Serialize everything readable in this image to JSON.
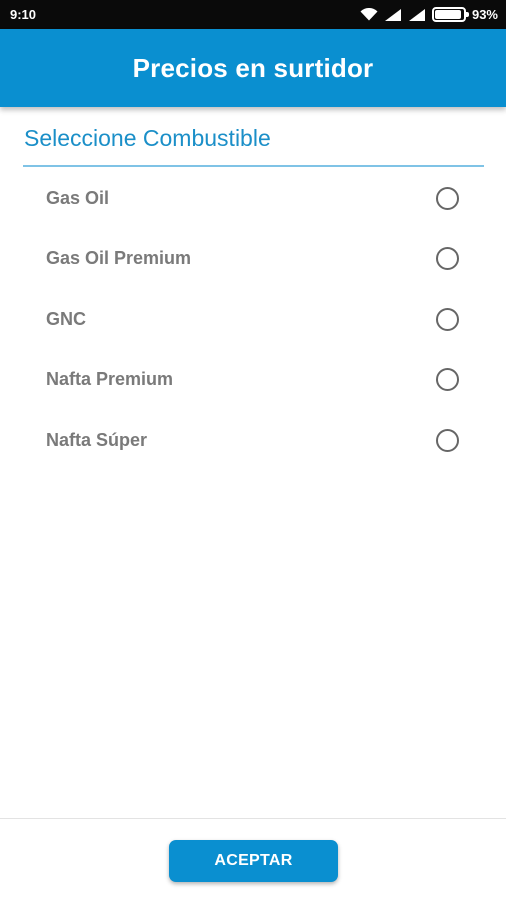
{
  "status_bar": {
    "time": "9:10",
    "battery_percent": "93%",
    "battery_level": 0.93,
    "icons": [
      "wifi-icon",
      "signal-icon",
      "signal-icon",
      "battery-icon"
    ]
  },
  "app_bar": {
    "title": "Precios en surtidor"
  },
  "fuel_section": {
    "title": "Seleccione Combustible",
    "options": [
      {
        "label": "Gas Oil",
        "selected": false
      },
      {
        "label": "Gas Oil Premium",
        "selected": false
      },
      {
        "label": "GNC",
        "selected": false
      },
      {
        "label": "Nafta Premium",
        "selected": false
      },
      {
        "label": "Nafta Súper",
        "selected": false
      }
    ]
  },
  "footer": {
    "accept_label": "ACEPTAR"
  },
  "colors": {
    "primary": "#0a8fd0",
    "section_title": "#1b8fc8",
    "divider": "#7fc3e6",
    "option_text": "#7a7a7a",
    "status_bar": "#0a0a0a"
  }
}
